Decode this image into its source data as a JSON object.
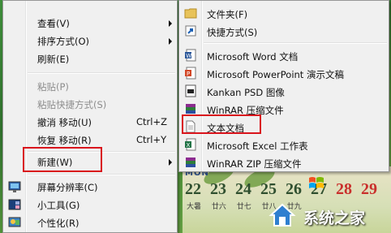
{
  "menu": {
    "items": [
      {
        "label": "查看(V)",
        "submenu": true
      },
      {
        "label": "排序方式(O)",
        "submenu": true
      },
      {
        "label": "刷新(E)"
      },
      {
        "label": "粘贴(P)",
        "disabled": true
      },
      {
        "label": "粘贴快捷方式(S)",
        "disabled": true
      },
      {
        "label": "撤消 移动(U)",
        "shortcut": "Ctrl+Z"
      },
      {
        "label": "恢复 移动(R)",
        "shortcut": "Ctrl+Y"
      },
      {
        "label": "新建(W)",
        "submenu": true,
        "highlighted": true
      },
      {
        "label": "屏幕分辨率(C)",
        "icon": "monitor-icon"
      },
      {
        "label": "小工具(G)",
        "icon": "gadgets-icon"
      },
      {
        "label": "个性化(R)",
        "icon": "personalize-icon"
      }
    ]
  },
  "submenu": {
    "items": [
      {
        "label": "文件夹(F)",
        "icon": "folder-icon"
      },
      {
        "label": "快捷方式(S)",
        "icon": "shortcut-icon"
      },
      {
        "label": "Microsoft Word 文档",
        "icon": "word-doc-icon"
      },
      {
        "label": "Microsoft PowerPoint 演示文稿",
        "icon": "powerpoint-icon"
      },
      {
        "label": "Kankan PSD 图像",
        "icon": "psd-icon"
      },
      {
        "label": "WinRAR 压缩文件",
        "icon": "winrar-icon"
      },
      {
        "label": "文本文档",
        "icon": "text-doc-icon",
        "highlighted": true
      },
      {
        "label": "Microsoft Excel 工作表",
        "icon": "excel-icon"
      },
      {
        "label": "WinRAR ZIP 压缩文件",
        "icon": "winrar-zip-icon"
      }
    ]
  },
  "desktop": {
    "month": "MON",
    "days": [
      "22",
      "23",
      "24",
      "25",
      "26",
      "27",
      "28",
      "29"
    ],
    "lunar": [
      "大暑",
      "廿六",
      "廿七",
      "廿八",
      "廿九"
    ]
  },
  "watermark": {
    "text": "系统之家"
  },
  "colors": {
    "highlight_box": "#d9141c",
    "menu_bg": "#f0f0f0"
  }
}
